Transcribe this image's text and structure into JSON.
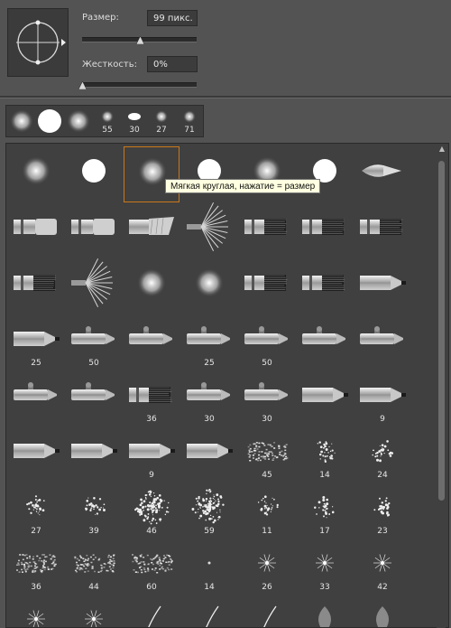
{
  "size": {
    "label": "Размер:",
    "value": "99 пикс.",
    "slider_fraction": 0.5
  },
  "hardness": {
    "label": "Жесткость:",
    "value": "0%",
    "slider_fraction": 0.0
  },
  "recent_brushes": [
    {
      "shape": "soft-round",
      "number": ""
    },
    {
      "shape": "hard-round",
      "number": ""
    },
    {
      "shape": "soft-round",
      "number": ""
    },
    {
      "shape": "soft-small",
      "number": "55"
    },
    {
      "shape": "ellipse",
      "number": "30"
    },
    {
      "shape": "soft-small",
      "number": "27"
    },
    {
      "shape": "soft-small",
      "number": "71"
    }
  ],
  "tooltip": "Мягкая круглая, нажатие = размер",
  "selected_brush_index": 2,
  "brush_grid": [
    {
      "icon": "soft-round",
      "n": ""
    },
    {
      "icon": "hard-round",
      "n": ""
    },
    {
      "icon": "soft-round",
      "n": ""
    },
    {
      "icon": "hard-round",
      "n": ""
    },
    {
      "icon": "soft-round",
      "n": ""
    },
    {
      "icon": "hard-round",
      "n": ""
    },
    {
      "icon": "round-point-brush",
      "n": ""
    },
    {
      "icon": "flat-brush",
      "n": ""
    },
    {
      "icon": "flat-brush",
      "n": ""
    },
    {
      "icon": "angled-brush",
      "n": ""
    },
    {
      "icon": "fan-brush",
      "n": ""
    },
    {
      "icon": "bristle-brush",
      "n": ""
    },
    {
      "icon": "bristle-brush",
      "n": ""
    },
    {
      "icon": "bristle-brush",
      "n": ""
    },
    {
      "icon": "bristle-brush",
      "n": ""
    },
    {
      "icon": "fan-brush",
      "n": ""
    },
    {
      "icon": "soft-round",
      "n": ""
    },
    {
      "icon": "soft-round",
      "n": ""
    },
    {
      "icon": "bristle-brush",
      "n": ""
    },
    {
      "icon": "bristle-brush",
      "n": ""
    },
    {
      "icon": "pencil-tip",
      "n": ""
    },
    {
      "icon": "pencil-tip",
      "n": "25"
    },
    {
      "icon": "airbrush",
      "n": "50"
    },
    {
      "icon": "airbrush",
      "n": ""
    },
    {
      "icon": "airbrush",
      "n": "25"
    },
    {
      "icon": "airbrush",
      "n": "50"
    },
    {
      "icon": "airbrush",
      "n": ""
    },
    {
      "icon": "airbrush",
      "n": ""
    },
    {
      "icon": "airbrush",
      "n": ""
    },
    {
      "icon": "airbrush",
      "n": ""
    },
    {
      "icon": "bristle-brush",
      "n": "36"
    },
    {
      "icon": "airbrush",
      "n": "30"
    },
    {
      "icon": "airbrush",
      "n": "30"
    },
    {
      "icon": "pencil-tip",
      "n": ""
    },
    {
      "icon": "pencil-tip",
      "n": "9"
    },
    {
      "icon": "pencil-tip",
      "n": ""
    },
    {
      "icon": "pencil-tip",
      "n": ""
    },
    {
      "icon": "pencil-tip",
      "n": "9"
    },
    {
      "icon": "pencil-tip",
      "n": ""
    },
    {
      "icon": "chalk",
      "n": "45"
    },
    {
      "icon": "spatter",
      "n": "14"
    },
    {
      "icon": "spatter",
      "n": "24"
    },
    {
      "icon": "spatter",
      "n": "27"
    },
    {
      "icon": "spatter",
      "n": "39"
    },
    {
      "icon": "spatter-large",
      "n": "46"
    },
    {
      "icon": "spatter-large",
      "n": "59"
    },
    {
      "icon": "spatter",
      "n": "11"
    },
    {
      "icon": "spatter",
      "n": "17"
    },
    {
      "icon": "spatter",
      "n": "23"
    },
    {
      "icon": "chalk",
      "n": "36"
    },
    {
      "icon": "chalk",
      "n": "44"
    },
    {
      "icon": "chalk",
      "n": "60"
    },
    {
      "icon": "dot",
      "n": "14"
    },
    {
      "icon": "star",
      "n": "26"
    },
    {
      "icon": "star",
      "n": "33"
    },
    {
      "icon": "star",
      "n": "42"
    },
    {
      "icon": "star",
      "n": ""
    },
    {
      "icon": "star",
      "n": ""
    },
    {
      "icon": "grass",
      "n": ""
    },
    {
      "icon": "grass",
      "n": ""
    },
    {
      "icon": "grass",
      "n": ""
    },
    {
      "icon": "leaf",
      "n": ""
    },
    {
      "icon": "leaf",
      "n": ""
    }
  ]
}
